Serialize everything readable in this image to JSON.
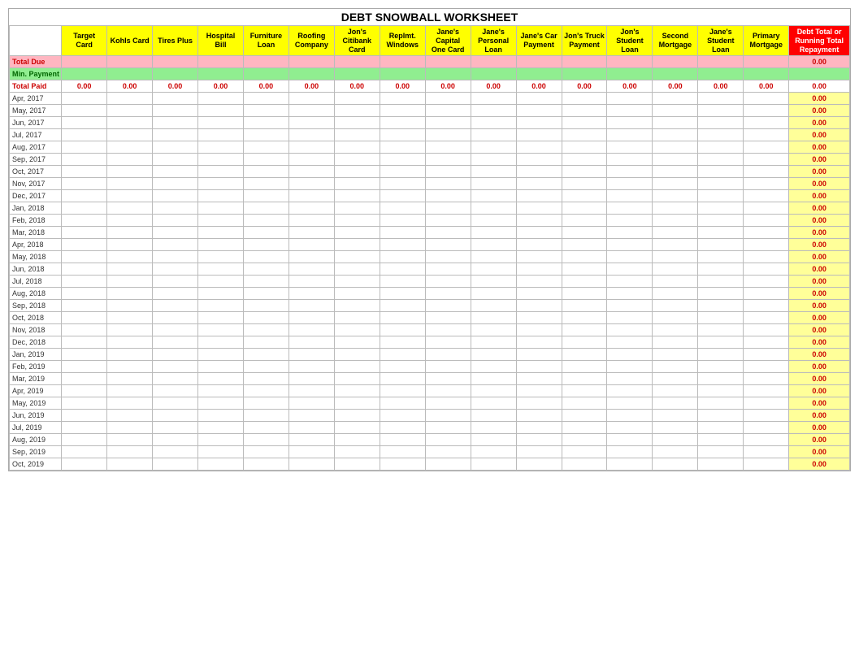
{
  "title": "DEBT SNOWBALL WORKSHEET",
  "columns": [
    {
      "key": "date",
      "label": "",
      "sub": ""
    },
    {
      "key": "target",
      "label": "Target",
      "sub": "Card"
    },
    {
      "key": "kohls",
      "label": "Kohls Card",
      "sub": ""
    },
    {
      "key": "tires",
      "label": "Tires Plus",
      "sub": ""
    },
    {
      "key": "hospital",
      "label": "Hospital",
      "sub": "Bill"
    },
    {
      "key": "furniture",
      "label": "Furniture",
      "sub": "Loan"
    },
    {
      "key": "roofing",
      "label": "Roofing",
      "sub": "Company"
    },
    {
      "key": "jons_citi",
      "label": "Jon's",
      "sub": "Citibank Card"
    },
    {
      "key": "replmt",
      "label": "Replmt.",
      "sub": "Windows"
    },
    {
      "key": "janes_capital",
      "label": "Jane's",
      "sub": "Capital One Card"
    },
    {
      "key": "janes_personal",
      "label": "Jane's",
      "sub": "Personal Loan"
    },
    {
      "key": "janes_car",
      "label": "Jane's Car",
      "sub": "Payment"
    },
    {
      "key": "jons_truck",
      "label": "Jon's Truck",
      "sub": "Payment"
    },
    {
      "key": "jons_student",
      "label": "Jon's",
      "sub": "Student Loan"
    },
    {
      "key": "second_mortgage",
      "label": "Second",
      "sub": "Mortgage"
    },
    {
      "key": "janes_student",
      "label": "Jane's",
      "sub": "Student Loan"
    },
    {
      "key": "primary_mortgage",
      "label": "Primary",
      "sub": "Mortgage"
    },
    {
      "key": "total",
      "label": "Debt Total or Running Total",
      "sub": "Repayment"
    }
  ],
  "total_due_label": "Total Due",
  "min_payment_label": "Min. Payment",
  "total_paid_label": "Total Paid",
  "total_paid_values": [
    "0.00",
    "0.00",
    "0.00",
    "0.00",
    "0.00",
    "0.00",
    "0.00",
    "0.00",
    "0.00",
    "0.00",
    "0.00",
    "0.00",
    "0.00",
    "0.00",
    "0.00",
    "0.00",
    "0.00"
  ],
  "rows": [
    {
      "date": "Apr, 2017",
      "value": "0.00"
    },
    {
      "date": "May, 2017",
      "value": "0.00"
    },
    {
      "date": "Jun, 2017",
      "value": "0.00"
    },
    {
      "date": "Jul, 2017",
      "value": "0.00"
    },
    {
      "date": "Aug, 2017",
      "value": "0.00"
    },
    {
      "date": "Sep, 2017",
      "value": "0.00"
    },
    {
      "date": "Oct, 2017",
      "value": "0.00"
    },
    {
      "date": "Nov, 2017",
      "value": "0.00"
    },
    {
      "date": "Dec, 2017",
      "value": "0.00"
    },
    {
      "date": "Jan, 2018",
      "value": "0.00"
    },
    {
      "date": "Feb, 2018",
      "value": "0.00"
    },
    {
      "date": "Mar, 2018",
      "value": "0.00"
    },
    {
      "date": "Apr, 2018",
      "value": "0.00"
    },
    {
      "date": "May, 2018",
      "value": "0.00"
    },
    {
      "date": "Jun, 2018",
      "value": "0.00"
    },
    {
      "date": "Jul, 2018",
      "value": "0.00"
    },
    {
      "date": "Aug, 2018",
      "value": "0.00"
    },
    {
      "date": "Sep, 2018",
      "value": "0.00"
    },
    {
      "date": "Oct, 2018",
      "value": "0.00"
    },
    {
      "date": "Nov, 2018",
      "value": "0.00"
    },
    {
      "date": "Dec, 2018",
      "value": "0.00"
    },
    {
      "date": "Jan, 2019",
      "value": "0.00"
    },
    {
      "date": "Feb, 2019",
      "value": "0.00"
    },
    {
      "date": "Mar, 2019",
      "value": "0.00"
    },
    {
      "date": "Apr, 2019",
      "value": "0.00"
    },
    {
      "date": "May, 2019",
      "value": "0.00"
    },
    {
      "date": "Jun, 2019",
      "value": "0.00"
    },
    {
      "date": "Jul, 2019",
      "value": "0.00"
    },
    {
      "date": "Aug, 2019",
      "value": "0.00"
    },
    {
      "date": "Sep, 2019",
      "value": "0.00"
    },
    {
      "date": "Oct, 2019",
      "value": "0.00"
    }
  ]
}
